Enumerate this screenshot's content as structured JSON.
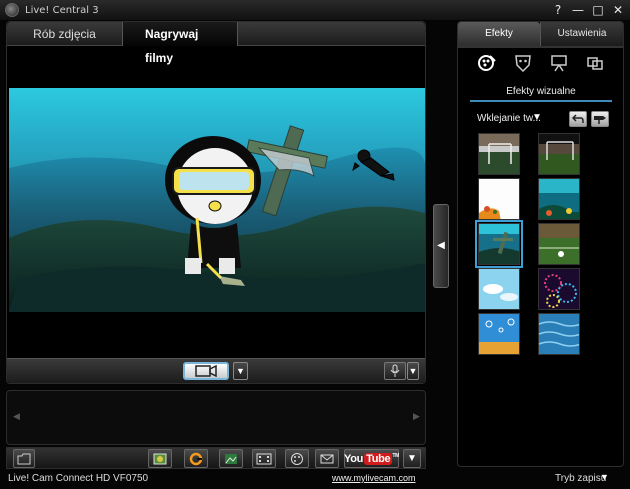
{
  "window": {
    "title": "Live! Central 3",
    "buttons": {
      "help": "?",
      "minimize": "—",
      "maximize": "□",
      "close": "✕"
    }
  },
  "main": {
    "tabs": [
      {
        "label": "Rób zdjęcia",
        "active": false
      },
      {
        "label": "Nagrywaj filmy",
        "active": true
      }
    ]
  },
  "filmstrip": {
    "prev": "◀",
    "next": "▶"
  },
  "collapse": {
    "glyph": "◀"
  },
  "bottom_toolbar": {
    "youtube_you": "You",
    "youtube_tube": "Tube",
    "youtube_tm": "TM",
    "dropdown": "▼"
  },
  "video_toolbar": {
    "record_dropdown": "▼",
    "mic_dropdown": "▼"
  },
  "status": {
    "device": "Live! Cam Connect HD VF0750",
    "link": "www.mylivecam.com",
    "mode_label": "Tryb zapisu",
    "mode_caret": "▼"
  },
  "right_panel": {
    "tabs": [
      {
        "label": "Efekty",
        "active": true
      },
      {
        "label": "Ustawienia",
        "active": false
      }
    ],
    "section_title": "Efekty wizualne",
    "category": {
      "label": "Wklejanie tw...",
      "caret": "▼"
    },
    "icons": [
      "effects-icon",
      "face-mask-icon",
      "presentation-icon",
      "overlay-icon"
    ],
    "thumbnails": [
      {
        "name": "stadium",
        "selected": false
      },
      {
        "name": "stadium-goal",
        "selected": false
      },
      {
        "name": "beach-flowers",
        "selected": false
      },
      {
        "name": "underwater-reef",
        "selected": false
      },
      {
        "name": "shipwreck",
        "selected": true
      },
      {
        "name": "soccer-field",
        "selected": false
      },
      {
        "name": "clouds",
        "selected": false
      },
      {
        "name": "fireworks",
        "selected": false
      },
      {
        "name": "bubbles",
        "selected": false
      },
      {
        "name": "water-ripples",
        "selected": false
      }
    ]
  },
  "colors": {
    "accent": "#3d8bb9",
    "youtube_red": "#d01c1c",
    "selection": "#3da0d6"
  }
}
